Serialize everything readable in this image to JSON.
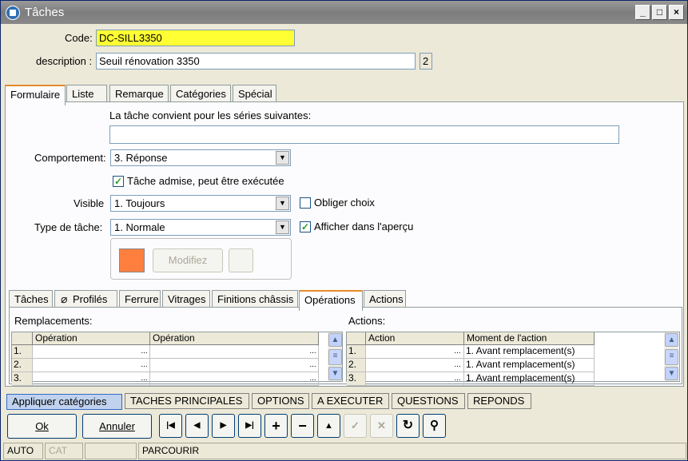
{
  "window": {
    "title": "Tâches",
    "minimize": "_",
    "maximize": "□",
    "close": "×"
  },
  "form": {
    "code_label": "Code:",
    "code_value": "DC-SILL3350",
    "description_label": "description :",
    "description_value": "Seuil rénovation 3350",
    "description_count": "2"
  },
  "main_tabs": [
    "Formulaire",
    "Liste",
    "Remarque",
    "Catégories",
    "Spécial"
  ],
  "formulaire": {
    "series_label": "La tâche convient pour les séries suivantes:",
    "series_value": "",
    "comportement_label": "Comportement:",
    "comportement_value": "3.  Réponse",
    "admise_label": "Tâche admise, peut être exécutée",
    "visible_label": "Visible",
    "visible_value": "1.  Toujours",
    "obliger_label": "Obliger choix",
    "type_label": "Type de tâche:",
    "type_value": "1.  Normale",
    "apercu_label": "Afficher dans l'aperçu",
    "color": "#ff7f3f",
    "modify_label": "Modifiez"
  },
  "sub_tabs": [
    "Tâches",
    "Profilés",
    "Ferrure",
    "Vitrages",
    "Finitions châssis",
    "Opérations",
    "Actions"
  ],
  "operations": {
    "replacements_title": "Remplacements:",
    "replacements_headers": [
      "Opération",
      "Opération"
    ],
    "actions_title": "Actions:",
    "actions_headers": [
      "Action",
      "Moment de l'action"
    ],
    "rows": [
      "1.",
      "2.",
      "3."
    ],
    "moments": [
      "1. Avant remplacement(s)",
      "1. Avant remplacement(s)",
      "1. Avant remplacement(s)"
    ],
    "ellipsis": "..."
  },
  "option_buttons": [
    "Appliquer catégories",
    "TACHES PRINCIPALES",
    "OPTIONS",
    "A EXECUTER",
    "QUESTIONS",
    "REPONDS"
  ],
  "buttons": {
    "ok": "Ok",
    "cancel": "Annuler"
  },
  "nav": {
    "first": "|◀",
    "prev": "◀",
    "next": "▶",
    "last": "▶|",
    "add": "+",
    "remove": "−",
    "up": "▲",
    "confirm": "✓",
    "discard": "✕",
    "refresh": "↻",
    "find": "⚲"
  },
  "status": {
    "mode": "AUTO",
    "cat": "CAT",
    "empty": "",
    "state": "PARCOURIR"
  }
}
